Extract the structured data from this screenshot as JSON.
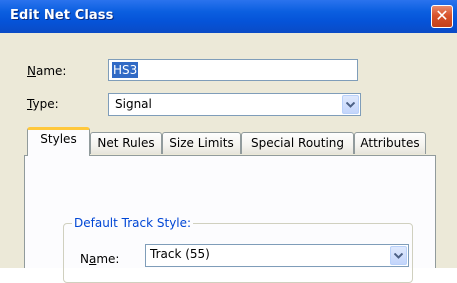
{
  "window": {
    "title": "Edit Net Class",
    "close_icon": "close-icon",
    "close_glyph": "✕"
  },
  "form": {
    "name_label": "Name:",
    "name_value": "HS3",
    "type_label": "Type:",
    "type_value": "Signal"
  },
  "tabs": [
    {
      "label": "Styles",
      "active": true
    },
    {
      "label": "Net Rules",
      "active": false
    },
    {
      "label": "Size Limits",
      "active": false
    },
    {
      "label": "Special Routing",
      "active": false
    },
    {
      "label": "Attributes",
      "active": false
    }
  ],
  "styles_tab": {
    "group_title": "Default Track Style:",
    "track_name_label": "Name:",
    "track_name_value": "Track (55)"
  },
  "colors": {
    "titlebar": "#0553d8",
    "dialog_bg": "#ece9d8",
    "selection": "#316ac5",
    "group_title": "#0046d5",
    "active_tab_highlight": "#ffc83c"
  }
}
